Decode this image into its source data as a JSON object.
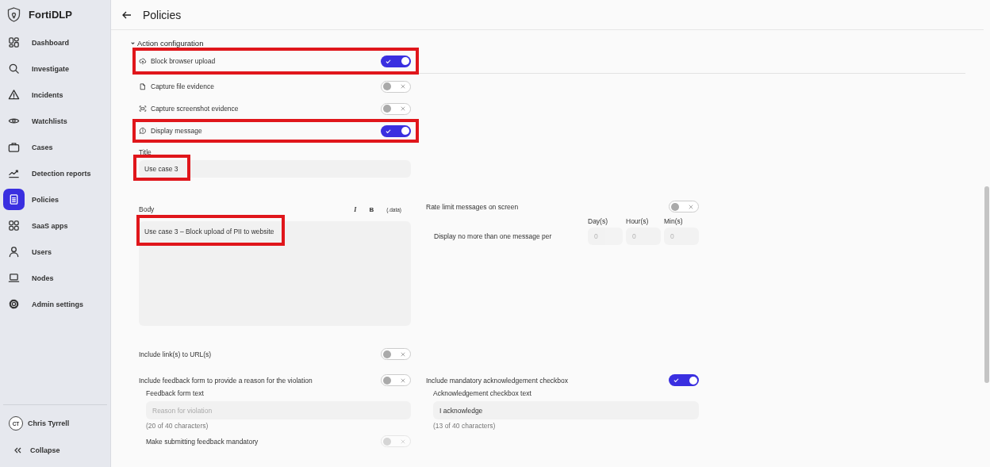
{
  "sidebar": {
    "brand": "FortiDLP",
    "items": [
      {
        "label": "Dashboard",
        "selected": false
      },
      {
        "label": "Investigate",
        "selected": false
      },
      {
        "label": "Incidents",
        "selected": false
      },
      {
        "label": "Watchlists",
        "selected": false
      },
      {
        "label": "Cases",
        "selected": false
      },
      {
        "label": "Detection reports",
        "selected": false
      },
      {
        "label": "Policies",
        "selected": true
      },
      {
        "label": "SaaS apps",
        "selected": false
      },
      {
        "label": "Users",
        "selected": false
      },
      {
        "label": "Nodes",
        "selected": false
      },
      {
        "label": "Admin settings",
        "selected": false
      }
    ],
    "user": {
      "initials": "CT",
      "name": "Chris Tyrrell"
    },
    "collapse": "Collapse"
  },
  "header": {
    "title": "Policies"
  },
  "section": {
    "title": "Action configuration",
    "expanded": true
  },
  "actions": [
    {
      "label": "Block browser upload",
      "on": true,
      "highlighted": true
    },
    {
      "label": "Capture file evidence",
      "on": false,
      "highlighted": false
    },
    {
      "label": "Capture screenshot evidence",
      "on": false,
      "highlighted": false
    },
    {
      "label": "Display message",
      "on": true,
      "highlighted": true
    }
  ],
  "title_field": {
    "label": "Title",
    "value": "Use case 3",
    "highlighted": true
  },
  "body_field": {
    "label": "Body",
    "format_buttons": [
      {
        "kind": "italic",
        "text": "I"
      },
      {
        "kind": "bold",
        "text": "B"
      },
      {
        "kind": "data",
        "text": "(.data)"
      }
    ],
    "value": "Use case 3 – Block upload of PII to website",
    "highlighted": true
  },
  "rate_limit": {
    "label": "Rate limit messages on screen",
    "on": false,
    "prompt": "Display no more than one message per",
    "units": [
      {
        "label": "Day(s)",
        "placeholder": "0"
      },
      {
        "label": "Hour(s)",
        "placeholder": "0"
      },
      {
        "label": "Min(s)",
        "placeholder": "0"
      }
    ]
  },
  "include_links": {
    "label": "Include link(s) to URL(s)",
    "on": false
  },
  "feedback": {
    "label": "Include feedback form to provide a reason for the violation",
    "on": false,
    "text_label": "Feedback form text",
    "placeholder": "Reason for violation",
    "count": "(20 of 40 characters)",
    "mandatory": {
      "label": "Make submitting feedback mandatory",
      "on": false,
      "disabled": true
    }
  },
  "acknowledgement": {
    "label": "Include mandatory acknowledgement checkbox",
    "on": true,
    "text_label": "Acknowledgement checkbox text",
    "value": "I acknowledge",
    "count": "(13 of 40 characters)"
  }
}
